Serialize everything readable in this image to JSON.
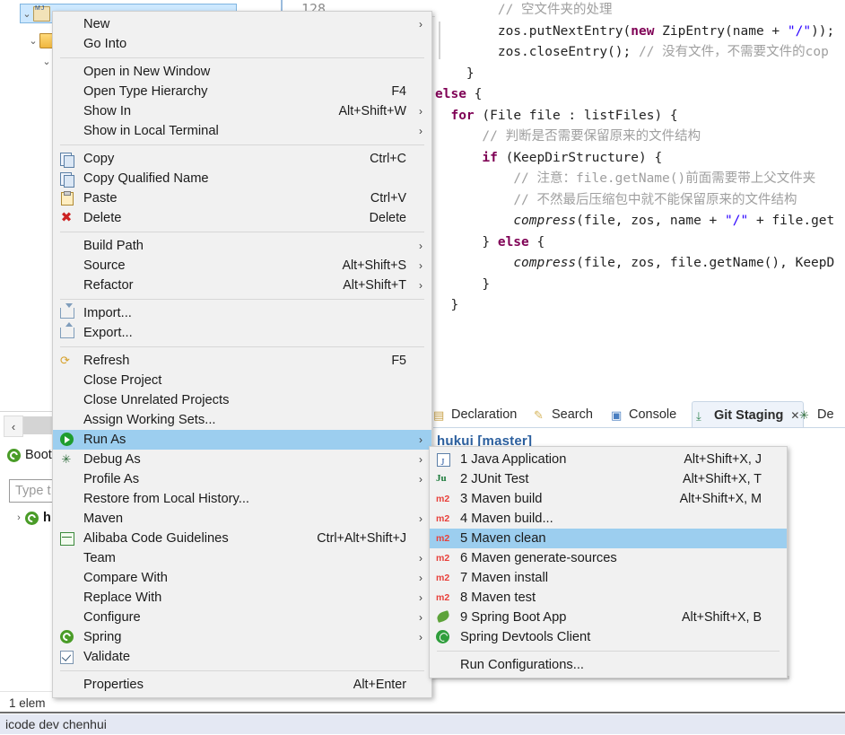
{
  "editor": {
    "line_number": "128",
    "code_lines": [
      [
        {
          "t": "        ",
          "c": "pl"
        },
        {
          "t": "// 空文件夹的处理",
          "c": "cm"
        }
      ],
      [
        {
          "t": "        zos.putNextEntry(",
          "c": "pl"
        },
        {
          "t": "new",
          "c": "kw"
        },
        {
          "t": " ZipEntry(name + ",
          "c": "pl"
        },
        {
          "t": "\"/\"",
          "c": "st"
        },
        {
          "t": "));",
          "c": "pl"
        }
      ],
      [
        {
          "t": "        zos.closeEntry(); ",
          "c": "pl"
        },
        {
          "t": "// 没有文件，不需要文件的cop",
          "c": "cm"
        }
      ],
      [
        {
          "t": "    }",
          "c": "pl"
        }
      ],
      [
        {
          "t": "",
          "c": "pl"
        }
      ],
      [
        {
          "t": "else",
          "c": "kw"
        },
        {
          "t": " {",
          "c": "pl"
        }
      ],
      [
        {
          "t": "  ",
          "c": "pl"
        },
        {
          "t": "for",
          "c": "kw"
        },
        {
          "t": " (File file : listFiles) {",
          "c": "pl"
        }
      ],
      [
        {
          "t": "      ",
          "c": "pl"
        },
        {
          "t": "// 判断是否需要保留原来的文件结构",
          "c": "cm"
        }
      ],
      [
        {
          "t": "      ",
          "c": "pl"
        },
        {
          "t": "if",
          "c": "kw"
        },
        {
          "t": " (KeepDirStructure) {",
          "c": "pl"
        }
      ],
      [
        {
          "t": "          ",
          "c": "pl"
        },
        {
          "t": "// 注意：file.getName()前面需要带上父文件夹",
          "c": "cm"
        }
      ],
      [
        {
          "t": "          ",
          "c": "pl"
        },
        {
          "t": "// 不然最后压缩包中就不能保留原来的文件结构",
          "c": "cm"
        }
      ],
      [
        {
          "t": "          ",
          "c": "pl"
        },
        {
          "t": "compress",
          "c": "it"
        },
        {
          "t": "(file, zos, name + ",
          "c": "pl"
        },
        {
          "t": "\"/\"",
          "c": "st"
        },
        {
          "t": " + file.get",
          "c": "pl"
        }
      ],
      [
        {
          "t": "      } ",
          "c": "pl"
        },
        {
          "t": "else",
          "c": "kw"
        },
        {
          "t": " {",
          "c": "pl"
        }
      ],
      [
        {
          "t": "          ",
          "c": "pl"
        },
        {
          "t": "compress",
          "c": "it"
        },
        {
          "t": "(file, zos, file.getName(), KeepD",
          "c": "pl"
        }
      ],
      [
        {
          "t": "      }",
          "c": "pl"
        }
      ],
      [
        {
          "t": "  }",
          "c": "pl"
        }
      ]
    ]
  },
  "view_tabs": [
    {
      "label": "Declaration",
      "icon": "declaration-icon",
      "active": false
    },
    {
      "label": "Search",
      "icon": "search-icon",
      "active": false
    },
    {
      "label": "Console",
      "icon": "console-icon",
      "active": false
    },
    {
      "label": "Git Staging",
      "icon": "git-staging-icon",
      "active": true,
      "close": "✕"
    },
    {
      "label": "De",
      "icon": "debug-icon",
      "active": false
    }
  ],
  "git_staging": {
    "repo_label": "hukui [master]"
  },
  "dashboard": {
    "collapse_icon": "‹",
    "boot_label": "Boot",
    "search_placeholder": "Type t",
    "item_label": "h"
  },
  "status": {
    "elements": "1 elem"
  },
  "taskbar": {
    "title": "icode dev chenhui"
  },
  "context_menu": {
    "items": [
      {
        "label": "New",
        "accel": "",
        "arrow": true,
        "icon": null,
        "selected": false
      },
      {
        "label": "Go Into",
        "accel": "",
        "arrow": false,
        "icon": null,
        "selected": false
      },
      {
        "separator": true
      },
      {
        "label": "Open in New Window",
        "accel": "",
        "arrow": false,
        "icon": null,
        "selected": false
      },
      {
        "label": "Open Type Hierarchy",
        "accel": "F4",
        "arrow": false,
        "icon": null,
        "selected": false
      },
      {
        "label": "Show In",
        "accel": "Alt+Shift+W",
        "arrow": true,
        "icon": null,
        "selected": false
      },
      {
        "label": "Show in Local Terminal",
        "accel": "",
        "arrow": true,
        "icon": null,
        "selected": false
      },
      {
        "separator": true
      },
      {
        "label": "Copy",
        "accel": "Ctrl+C",
        "arrow": false,
        "icon": "copy-icon",
        "selected": false
      },
      {
        "label": "Copy Qualified Name",
        "accel": "",
        "arrow": false,
        "icon": "copy-qualified-icon",
        "selected": false
      },
      {
        "label": "Paste",
        "accel": "Ctrl+V",
        "arrow": false,
        "icon": "paste-icon",
        "selected": false
      },
      {
        "label": "Delete",
        "accel": "Delete",
        "arrow": false,
        "icon": "delete-icon",
        "selected": false
      },
      {
        "separator": true
      },
      {
        "label": "Build Path",
        "accel": "",
        "arrow": true,
        "icon": null,
        "selected": false
      },
      {
        "label": "Source",
        "accel": "Alt+Shift+S",
        "arrow": true,
        "icon": null,
        "selected": false
      },
      {
        "label": "Refactor",
        "accel": "Alt+Shift+T",
        "arrow": true,
        "icon": null,
        "selected": false
      },
      {
        "separator": true
      },
      {
        "label": "Import...",
        "accel": "",
        "arrow": false,
        "icon": "import-icon",
        "selected": false
      },
      {
        "label": "Export...",
        "accel": "",
        "arrow": false,
        "icon": "export-icon",
        "selected": false
      },
      {
        "separator": true
      },
      {
        "label": "Refresh",
        "accel": "F5",
        "arrow": false,
        "icon": "refresh-icon",
        "selected": false
      },
      {
        "label": "Close Project",
        "accel": "",
        "arrow": false,
        "icon": null,
        "selected": false
      },
      {
        "label": "Close Unrelated Projects",
        "accel": "",
        "arrow": false,
        "icon": null,
        "selected": false
      },
      {
        "label": "Assign Working Sets...",
        "accel": "",
        "arrow": false,
        "icon": null,
        "selected": false
      },
      {
        "label": "Run As",
        "accel": "",
        "arrow": true,
        "icon": "run-icon",
        "selected": true
      },
      {
        "label": "Debug As",
        "accel": "",
        "arrow": true,
        "icon": "debug-icon",
        "selected": false
      },
      {
        "label": "Profile As",
        "accel": "",
        "arrow": true,
        "icon": null,
        "selected": false
      },
      {
        "label": "Restore from Local History...",
        "accel": "",
        "arrow": false,
        "icon": null,
        "selected": false
      },
      {
        "label": "Maven",
        "accel": "",
        "arrow": true,
        "icon": null,
        "selected": false
      },
      {
        "label": "Alibaba Code Guidelines",
        "accel": "Ctrl+Alt+Shift+J",
        "arrow": false,
        "icon": "alibaba-icon",
        "selected": false
      },
      {
        "label": "Team",
        "accel": "",
        "arrow": true,
        "icon": null,
        "selected": false
      },
      {
        "label": "Compare With",
        "accel": "",
        "arrow": true,
        "icon": null,
        "selected": false
      },
      {
        "label": "Replace With",
        "accel": "",
        "arrow": true,
        "icon": null,
        "selected": false
      },
      {
        "label": "Configure",
        "accel": "",
        "arrow": true,
        "icon": null,
        "selected": false
      },
      {
        "label": "Spring",
        "accel": "",
        "arrow": true,
        "icon": "spring-icon",
        "selected": false
      },
      {
        "label": "Validate",
        "accel": "",
        "arrow": false,
        "icon": "checkbox-icon",
        "selected": false
      },
      {
        "separator": true
      },
      {
        "label": "Properties",
        "accel": "Alt+Enter",
        "arrow": false,
        "icon": null,
        "selected": false
      }
    ]
  },
  "run_as_submenu": {
    "items": [
      {
        "label": "1 Java Application",
        "accel": "Alt+Shift+X, J",
        "icon": "java-icon",
        "selected": false
      },
      {
        "label": "2 JUnit Test",
        "accel": "Alt+Shift+X, T",
        "icon": "junit-icon",
        "selected": false
      },
      {
        "label": "3 Maven build",
        "accel": "Alt+Shift+X, M",
        "icon": "maven-icon",
        "selected": false
      },
      {
        "label": "4 Maven build...",
        "accel": "",
        "icon": "maven-icon",
        "selected": false
      },
      {
        "label": "5 Maven clean",
        "accel": "",
        "icon": "maven-icon",
        "selected": true
      },
      {
        "label": "6 Maven generate-sources",
        "accel": "",
        "icon": "maven-icon",
        "selected": false
      },
      {
        "label": "7 Maven install",
        "accel": "",
        "icon": "maven-icon",
        "selected": false
      },
      {
        "label": "8 Maven test",
        "accel": "",
        "icon": "maven-icon",
        "selected": false
      },
      {
        "label": "9 Spring Boot App",
        "accel": "Alt+Shift+X, B",
        "icon": "spring-leaf-icon",
        "selected": false
      },
      {
        "label": "Spring Devtools Client",
        "accel": "",
        "icon": "spring-devtools-icon",
        "selected": false
      },
      {
        "separator": true
      },
      {
        "label": "Run Configurations...",
        "accel": "",
        "icon": null,
        "selected": false
      }
    ]
  },
  "colors": {
    "menu_bg": "#f1f1f1",
    "selection_blue": "#9cceef",
    "tree_selection": "#cde8ff",
    "accent": "#2b5f9e",
    "maven_red": "#e8403a",
    "spring_green": "#4a9c28"
  }
}
